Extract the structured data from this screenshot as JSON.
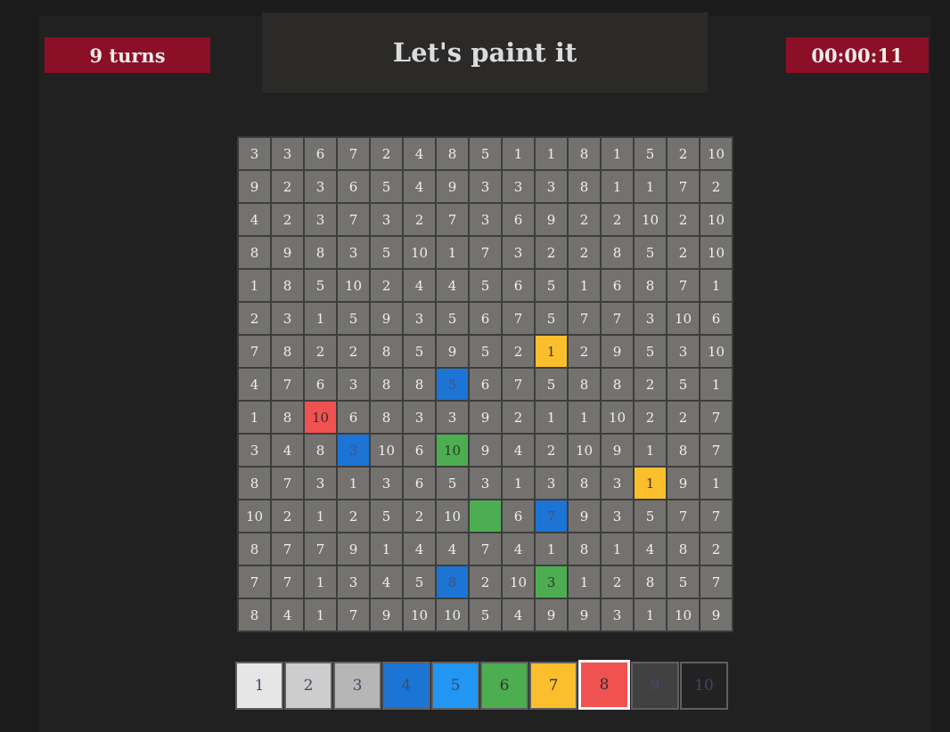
{
  "header": {
    "turns": "9 turns",
    "title": "Let's paint it",
    "timer": "00:00:11"
  },
  "colors": {
    "1": "#e6e6e6",
    "2": "#cdcdcd",
    "3": "#b6b6b6",
    "4": "#1c74d4",
    "5": "#2196f3",
    "6": "#4cae50",
    "7": "#fbbf2d",
    "8": "#ef5251",
    "9": "#424142",
    "10": "#232223"
  },
  "board": {
    "rows": [
      [
        "3",
        "3",
        "6",
        "7",
        "2",
        "4",
        "8",
        "5",
        "1",
        "1",
        "8",
        "1",
        "5",
        "2",
        "10"
      ],
      [
        "9",
        "2",
        "3",
        "6",
        "5",
        "4",
        "9",
        "3",
        "3",
        "3",
        "8",
        "1",
        "1",
        "7",
        "2"
      ],
      [
        "4",
        "2",
        "3",
        "7",
        "3",
        "2",
        "7",
        "3",
        "6",
        "9",
        "2",
        "2",
        "10",
        "2",
        "10"
      ],
      [
        "8",
        "9",
        "8",
        "3",
        "5",
        "10",
        "1",
        "7",
        "3",
        "2",
        "2",
        "8",
        "5",
        "2",
        "10"
      ],
      [
        "1",
        "8",
        "5",
        "10",
        "2",
        "4",
        "4",
        "5",
        "6",
        "5",
        "1",
        "6",
        "8",
        "7",
        "1"
      ],
      [
        "2",
        "3",
        "1",
        "5",
        "9",
        "3",
        "5",
        "6",
        "7",
        "5",
        "7",
        "7",
        "3",
        "10",
        "6"
      ],
      [
        "7",
        "8",
        "2",
        "2",
        "8",
        "5",
        "9",
        "5",
        "2",
        "1",
        "2",
        "9",
        "5",
        "3",
        "10"
      ],
      [
        "4",
        "7",
        "6",
        "3",
        "8",
        "8",
        "5",
        "6",
        "7",
        "5",
        "8",
        "8",
        "2",
        "5",
        "1"
      ],
      [
        "1",
        "8",
        "10",
        "6",
        "8",
        "3",
        "3",
        "9",
        "2",
        "1",
        "1",
        "10",
        "2",
        "2",
        "7"
      ],
      [
        "3",
        "4",
        "8",
        "3",
        "10",
        "6",
        "10",
        "9",
        "4",
        "2",
        "10",
        "9",
        "1",
        "8",
        "7"
      ],
      [
        "8",
        "7",
        "3",
        "1",
        "3",
        "6",
        "5",
        "3",
        "1",
        "3",
        "8",
        "3",
        "1",
        "9",
        "1"
      ],
      [
        "10",
        "2",
        "1",
        "2",
        "5",
        "2",
        "10",
        "",
        "6",
        "7",
        "9",
        "3",
        "5",
        "7",
        "7"
      ],
      [
        "8",
        "7",
        "7",
        "9",
        "1",
        "4",
        "4",
        "7",
        "4",
        "1",
        "8",
        "1",
        "4",
        "8",
        "2"
      ],
      [
        "7",
        "7",
        "1",
        "3",
        "4",
        "5",
        "8",
        "2",
        "10",
        "3",
        "1",
        "2",
        "8",
        "5",
        "7"
      ],
      [
        "8",
        "4",
        "1",
        "7",
        "9",
        "10",
        "10",
        "5",
        "4",
        "9",
        "9",
        "3",
        "1",
        "10",
        "9"
      ]
    ],
    "painted": [
      {
        "row": 6,
        "col": 9,
        "color": "7"
      },
      {
        "row": 7,
        "col": 6,
        "color": "4"
      },
      {
        "row": 8,
        "col": 2,
        "color": "8"
      },
      {
        "row": 9,
        "col": 3,
        "color": "4"
      },
      {
        "row": 9,
        "col": 6,
        "color": "6"
      },
      {
        "row": 10,
        "col": 12,
        "color": "7"
      },
      {
        "row": 11,
        "col": 7,
        "color": "6"
      },
      {
        "row": 11,
        "col": 9,
        "color": "4"
      },
      {
        "row": 13,
        "col": 6,
        "color": "4"
      },
      {
        "row": 13,
        "col": 9,
        "color": "6"
      }
    ]
  },
  "palette": {
    "selected": "8",
    "items": [
      {
        "label": "1",
        "color": "#e6e6e6",
        "text_color": "#3d4a6a"
      },
      {
        "label": "2",
        "color": "#cdcdcd",
        "text_color": "#3d4a6a"
      },
      {
        "label": "3",
        "color": "#b6b6b6",
        "text_color": "#3d4a6a"
      },
      {
        "label": "4",
        "color": "#1c74d4",
        "text_color": "#3d4a6a"
      },
      {
        "label": "5",
        "color": "#2196f3",
        "text_color": "#3d4a6a"
      },
      {
        "label": "6",
        "color": "#4cae50",
        "text_color": "#2c3a2a"
      },
      {
        "label": "7",
        "color": "#fbbf2d",
        "text_color": "#3a3228"
      },
      {
        "label": "8",
        "color": "#ef5251",
        "text_color": "#3a2a2a"
      },
      {
        "label": "9",
        "color": "#424142",
        "text_color": "#3d4a6a"
      },
      {
        "label": "10",
        "color": "#232223",
        "text_color": "#3d4a6a"
      }
    ]
  }
}
